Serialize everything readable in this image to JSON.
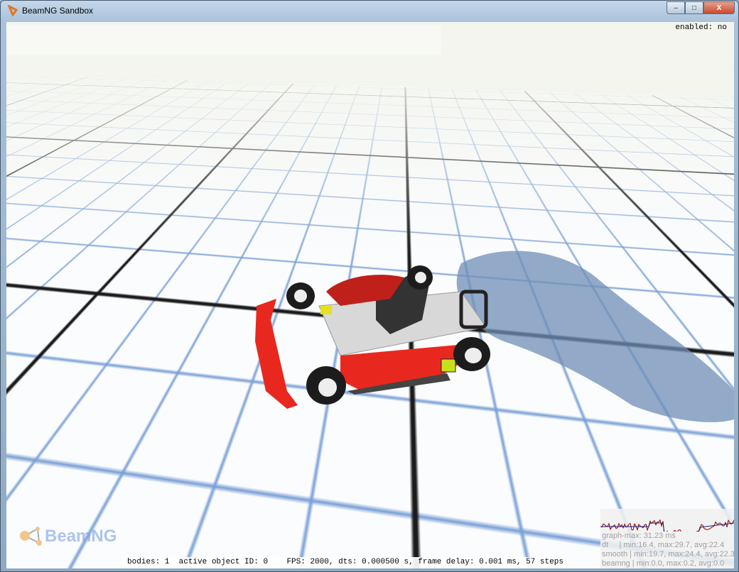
{
  "window": {
    "title": "BeamNG Sandbox",
    "minimize": "–",
    "maximize": "□",
    "close": "X"
  },
  "overlay": {
    "enabled": "enabled: no",
    "logo": "BeamNG"
  },
  "status": {
    "bodies": "bodies: 1",
    "active": "active object ID: 0",
    "fps": "FPS: 2000, dts: 0.000500 s, frame delay: 0.001 ms, 57 steps"
  },
  "perf": {
    "graph_max": "graph-max: 31.23 ms",
    "dt": "dt     | min:16.4, max:29.7, avg:22.4",
    "smooth": "smooth | min:19.7, max:24.4, avg:22.3",
    "beamng": "beamng | min:0.0, max:0.2, avg:0.0"
  },
  "colors": {
    "kart": "#e8281e",
    "dt_line": "#8b0000",
    "smooth_line": "#1a1a7a"
  }
}
